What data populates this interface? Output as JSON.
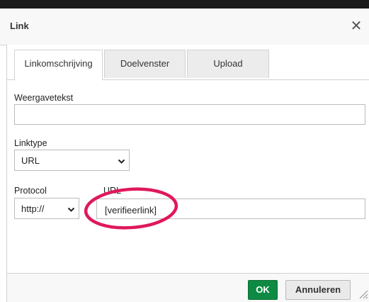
{
  "dialog": {
    "title": "Link",
    "close_glyph": "✕"
  },
  "tabs": [
    {
      "label": "Linkomschrijving",
      "active": true
    },
    {
      "label": "Doelvenster",
      "active": false
    },
    {
      "label": "Upload",
      "active": false
    }
  ],
  "form": {
    "display_text": {
      "label": "Weergavetekst",
      "value": ""
    },
    "link_type": {
      "label": "Linktype",
      "value": "URL"
    },
    "protocol": {
      "label": "Protocol",
      "value": "http://"
    },
    "url": {
      "label": "URL",
      "value": "[verifieerlink]"
    }
  },
  "footer": {
    "ok_label": "OK",
    "cancel_label": "Annuleren"
  },
  "colors": {
    "ok_button": "#0e8a44",
    "highlight_circle": "#e0185a"
  },
  "icons": [
    "close-icon",
    "chevron-down-icon",
    "resize-handle-icon"
  ]
}
